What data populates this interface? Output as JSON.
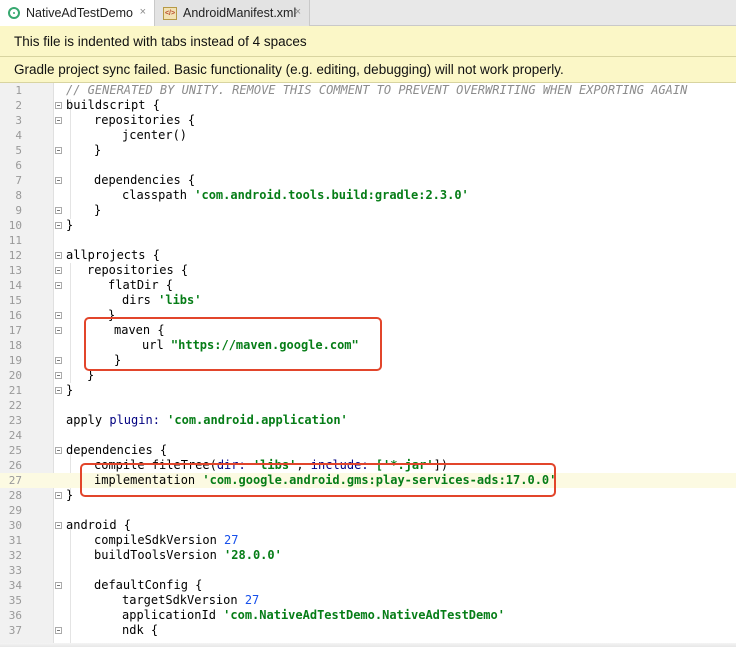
{
  "tabs": [
    {
      "label": "NativeAdTestDemo",
      "icon": "gradle-icon",
      "active": true
    },
    {
      "label": "AndroidManifest.xml",
      "icon": "xml-file-icon",
      "active": false
    }
  ],
  "tab_close_glyph": "×",
  "xml_icon_text": "</>",
  "banners": [
    "This file is indented with tabs instead of 4 spaces",
    "Gradle project sync failed. Basic functionality (e.g. editing, debugging) will not work properly."
  ],
  "colors": {
    "banner_bg": "#fbf7c7",
    "string": "#067d17",
    "number": "#1750eb",
    "comment": "#8c8c8c",
    "highlight_box": "#e2452b",
    "current_line": "#fcfae2"
  },
  "code": {
    "l1": "// GENERATED BY UNITY. REMOVE THIS COMMENT TO PREVENT OVERWRITING WHEN EXPORTING AGAIN",
    "l2": "buildscript {",
    "l3": "repositories {",
    "l4": "jcenter()",
    "l5": "}",
    "l7": "dependencies {",
    "l8a": "classpath ",
    "l8b": "'com.android.tools.build:gradle:2.3.0'",
    "l9": "}",
    "l10": "}",
    "l12": "allprojects {",
    "l13": "repositories {",
    "l14": "flatDir {",
    "l15a": "dirs ",
    "l15b": "'libs'",
    "l16": "}",
    "l17": "maven {",
    "l18a": "url ",
    "l18b": "\"https://maven.google.com\"",
    "l19": "}",
    "l20": "}",
    "l21": "}",
    "l23a": "apply ",
    "l23b": "plugin: ",
    "l23c": "'com.android.application'",
    "l25": "dependencies {",
    "l26a": "compile fileTree(",
    "l26b": "dir: ",
    "l26c": "'libs'",
    "l26d": ", ",
    "l26e": "include: ",
    "l26f": "['*.jar'",
    "l26g": "])",
    "l27a": "implementation ",
    "l27b": "'com.google.android.gms:play-services-ads:17.0.0'",
    "l28": "}",
    "l30": "android {",
    "l31a": "compileSdkVersion ",
    "l31b": "27",
    "l32a": "buildToolsVersion ",
    "l32b": "'28.0.0'",
    "l34": "defaultConfig {",
    "l35a": "targetSdkVersion ",
    "l35b": "27",
    "l36a": "applicationId ",
    "l36b": "'com.NativeAdTestDemo.NativeAdTestDemo'",
    "l37": "ndk {"
  },
  "line_numbers": [
    "1",
    "2",
    "3",
    "4",
    "5",
    "6",
    "7",
    "8",
    "9",
    "10",
    "11",
    "12",
    "13",
    "14",
    "15",
    "16",
    "17",
    "18",
    "19",
    "20",
    "21",
    "22",
    "23",
    "24",
    "25",
    "26",
    "27",
    "28",
    "29",
    "30",
    "31",
    "32",
    "33",
    "34",
    "35",
    "36",
    "37"
  ]
}
